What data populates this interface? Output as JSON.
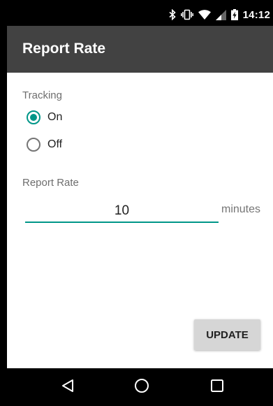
{
  "status_bar": {
    "time": "14:12",
    "icons": [
      "bluetooth-icon",
      "vibrate-icon",
      "wifi-icon",
      "signal-icon",
      "battery-charging-icon"
    ]
  },
  "app_bar": {
    "title": "Report Rate"
  },
  "tracking": {
    "label": "Tracking",
    "options": [
      {
        "label": "On",
        "selected": true
      },
      {
        "label": "Off",
        "selected": false
      }
    ]
  },
  "report_rate": {
    "label": "Report Rate",
    "value": "10",
    "unit": "minutes"
  },
  "actions": {
    "update_label": "UPDATE"
  },
  "nav_bar": {
    "buttons": [
      "back-icon",
      "home-icon",
      "recents-icon"
    ]
  },
  "colors": {
    "accent": "#009688",
    "app_bar": "#424242",
    "button": "#d6d6d6"
  }
}
